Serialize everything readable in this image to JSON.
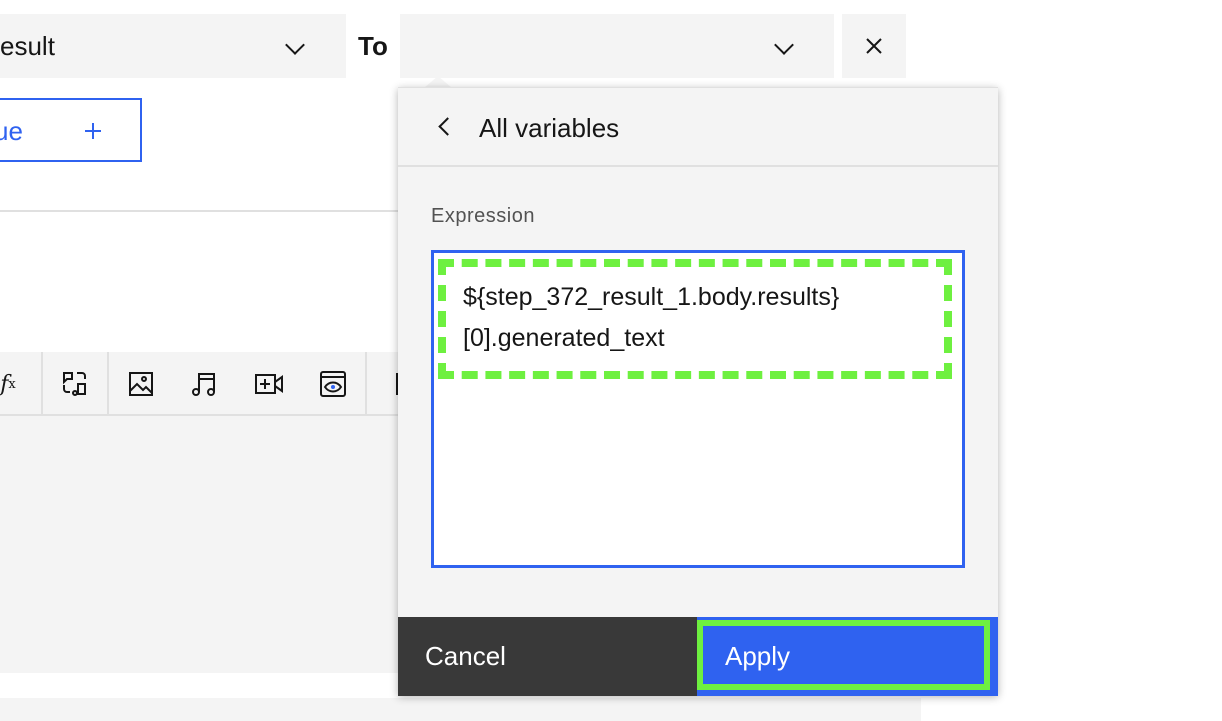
{
  "mapping": {
    "from_value": "esult",
    "to_label": "To",
    "to_value": "",
    "close_icon": "close-icon",
    "add_button_label": "ue",
    "add_icon": "plus-icon"
  },
  "toolbar": {
    "icons": [
      "function-icon",
      "transform-audio-icon",
      "image-icon",
      "music-icon",
      "video-add-icon",
      "view-icon",
      "partial-icon"
    ]
  },
  "popover": {
    "back_label": "All variables",
    "expression_label": "Expression",
    "expression_value": "${step_372_result_1.body.results}\n[0].generated_text",
    "cancel_label": "Cancel",
    "apply_label": "Apply"
  },
  "colors": {
    "accent": "#2f62f0",
    "highlight": "#6ef040",
    "cancel_bg": "#393939",
    "field_bg": "#f4f4f4"
  }
}
